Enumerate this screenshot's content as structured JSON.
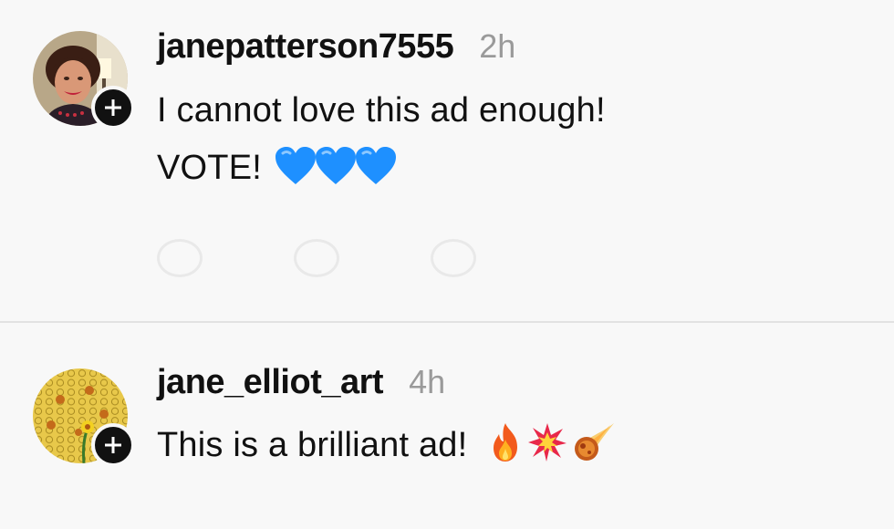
{
  "comments": [
    {
      "username": "janepatterson7555",
      "time": "2h",
      "line1": "I cannot love this ad enough!",
      "line2": "VOTE!",
      "line2_emoji": [
        "blue-heart-icon",
        "blue-heart-icon",
        "blue-heart-icon"
      ],
      "avatar": "profile-photo"
    },
    {
      "username": "jane_elliot_art",
      "time": "4h",
      "line1": "This is a brilliant ad!",
      "line1_emoji": [
        "fire-icon",
        "collision-icon",
        "comet-icon"
      ],
      "avatar": "honeycomb-art"
    }
  ],
  "colors": {
    "background": "#f8f8f8",
    "text": "#111111",
    "timestamp": "#9a9a9a",
    "divider": "#e2e2e2",
    "heart": "#1e90ff"
  }
}
